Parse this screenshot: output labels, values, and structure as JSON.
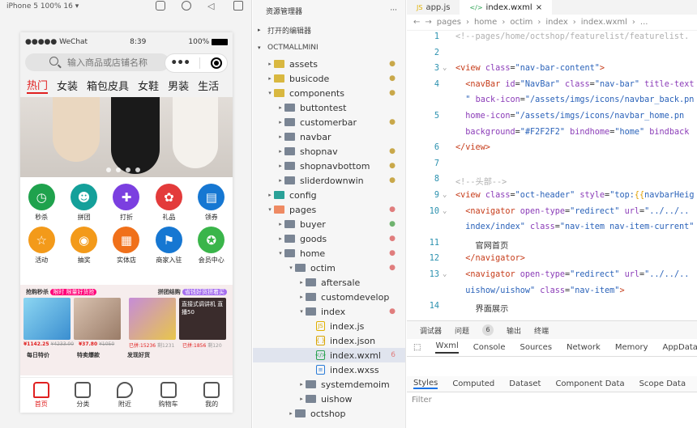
{
  "simulator": {
    "toolbar_label": "iPhone 5 100% 16 ▾",
    "status": {
      "carrier": "●●●●● WeChat",
      "time": "8:39",
      "battery": "100%"
    },
    "search_placeholder": "输入商品或店铺名称",
    "tabs": [
      "热门",
      "女装",
      "箱包皮具",
      "女鞋",
      "男装",
      "生活"
    ],
    "icons": [
      {
        "label": "秒杀",
        "color": "#1fa24d"
      },
      {
        "label": "拼团",
        "color": "#14a09a"
      },
      {
        "label": "打折",
        "color": "#7b3fe0"
      },
      {
        "label": "礼品",
        "color": "#e33b3b"
      },
      {
        "label": "领券",
        "color": "#1677d2"
      },
      {
        "label": "活动",
        "color": "#f39a1a"
      },
      {
        "label": "抽奖",
        "color": "#f39a1a"
      },
      {
        "label": "实体店",
        "color": "#f0701a"
      },
      {
        "label": "商家入驻",
        "color": "#1677d2"
      },
      {
        "label": "会员中心",
        "color": "#3ab54a"
      }
    ],
    "promo": {
      "left_title": "抢购秒杀",
      "left_pill": "限时 限量好货抢",
      "right_title": "拼团结购",
      "right_pill": "省钱好货拼着买",
      "p1": "¥1142.25",
      "p1_old": "¥4233.00",
      "p2": "¥37.80",
      "p2_old": "¥1050",
      "p3": "已拼:15236",
      "p3_b": "剩1231",
      "p4": "已拼:1856",
      "p4_b": "剩120",
      "row2": [
        "每日特价",
        "特卖爆款",
        "发现好货"
      ],
      "promo_text": "直接式调讲机 直播50"
    },
    "tabbar": [
      "首页",
      "分类",
      "附近",
      "购物车",
      "我的"
    ]
  },
  "explorer": {
    "title": "资源管理器",
    "more": "···",
    "open_editors": "打开的编辑器",
    "project": "OCTMALLMINI",
    "tree": [
      {
        "name": "assets",
        "indent": 0,
        "type": "folder",
        "color": "y",
        "arrow": "▸",
        "status": "●",
        "scol": "#c9a84a"
      },
      {
        "name": "busicode",
        "indent": 0,
        "type": "folder",
        "color": "y",
        "arrow": "▸",
        "status": "●",
        "scol": "#c9a84a"
      },
      {
        "name": "components",
        "indent": 0,
        "type": "folder",
        "color": "y",
        "arrow": "▾",
        "status": "●",
        "scol": "#c9a84a"
      },
      {
        "name": "buttontest",
        "indent": 1,
        "type": "folder",
        "color": "",
        "arrow": "▸",
        "status": "",
        "scol": ""
      },
      {
        "name": "customerbar",
        "indent": 1,
        "type": "folder",
        "color": "",
        "arrow": "▸",
        "status": "●",
        "scol": "#c9a84a"
      },
      {
        "name": "navbar",
        "indent": 1,
        "type": "folder",
        "color": "",
        "arrow": "▸",
        "status": "",
        "scol": ""
      },
      {
        "name": "shopnav",
        "indent": 1,
        "type": "folder",
        "color": "",
        "arrow": "▸",
        "status": "●",
        "scol": "#c9a84a"
      },
      {
        "name": "shopnavbottom",
        "indent": 1,
        "type": "folder",
        "color": "",
        "arrow": "▸",
        "status": "●",
        "scol": "#c9a84a"
      },
      {
        "name": "sliderdownwin",
        "indent": 1,
        "type": "folder",
        "color": "",
        "arrow": "▸",
        "status": "●",
        "scol": "#c9a84a"
      },
      {
        "name": "config",
        "indent": 0,
        "type": "folder",
        "color": "b",
        "arrow": "▸",
        "status": "",
        "scol": ""
      },
      {
        "name": "pages",
        "indent": 0,
        "type": "folder",
        "color": "o",
        "arrow": "▾",
        "status": "●",
        "scol": "#e07d7d"
      },
      {
        "name": "buyer",
        "indent": 1,
        "type": "folder",
        "color": "",
        "arrow": "▸",
        "status": "●",
        "scol": "#6fb36f"
      },
      {
        "name": "goods",
        "indent": 1,
        "type": "folder",
        "color": "",
        "arrow": "▸",
        "status": "●",
        "scol": "#e07d7d"
      },
      {
        "name": "home",
        "indent": 1,
        "type": "folder",
        "color": "",
        "arrow": "▾",
        "status": "●",
        "scol": "#e07d7d"
      },
      {
        "name": "octim",
        "indent": 2,
        "type": "folder",
        "color": "",
        "arrow": "▾",
        "status": "●",
        "scol": "#e07d7d"
      },
      {
        "name": "aftersale",
        "indent": 3,
        "type": "folder",
        "color": "",
        "arrow": "▸",
        "status": "",
        "scol": ""
      },
      {
        "name": "customdevelop",
        "indent": 3,
        "type": "folder",
        "color": "",
        "arrow": "▸",
        "status": "",
        "scol": ""
      },
      {
        "name": "index",
        "indent": 3,
        "type": "folder",
        "color": "",
        "arrow": "▾",
        "status": "●",
        "scol": "#e07d7d"
      },
      {
        "name": "index.js",
        "indent": 4,
        "type": "js",
        "color": "",
        "arrow": "",
        "status": "",
        "scol": ""
      },
      {
        "name": "index.json",
        "indent": 4,
        "type": "json",
        "color": "",
        "arrow": "",
        "status": "",
        "scol": ""
      },
      {
        "name": "index.wxml",
        "indent": 4,
        "type": "wxml",
        "color": "",
        "arrow": "",
        "status": "6",
        "scol": "#e07d7d",
        "selected": true
      },
      {
        "name": "index.wxss",
        "indent": 4,
        "type": "wxss",
        "color": "",
        "arrow": "",
        "status": "",
        "scol": ""
      },
      {
        "name": "systemdemoim",
        "indent": 3,
        "type": "folder",
        "color": "",
        "arrow": "▸",
        "status": "",
        "scol": ""
      },
      {
        "name": "uishow",
        "indent": 3,
        "type": "folder",
        "color": "",
        "arrow": "▸",
        "status": "",
        "scol": ""
      },
      {
        "name": "octshop",
        "indent": 2,
        "type": "folder",
        "color": "",
        "arrow": "▸",
        "status": "",
        "scol": ""
      }
    ]
  },
  "editor": {
    "tabs": [
      {
        "label": "app.js",
        "active": false
      },
      {
        "label": "index.wxml",
        "active": true
      }
    ],
    "breadcrumb": [
      "pages",
      "home",
      "octim",
      "index",
      "index.wxml",
      "..."
    ],
    "lines": [
      {
        "n": "1",
        "html": "<span class='cmt'>&lt;!--pages/home/octshop/featurelist/featurelist.</span>"
      },
      {
        "n": "2",
        "html": ""
      },
      {
        "n": "3",
        "fold": "⌄",
        "html": "<span class='tag'>&lt;view</span> <span class='atn'>class</span>=<span class='val'>\"nav-bar-content\"</span><span class='tag'>&gt;</span>"
      },
      {
        "n": "4",
        "html": "  <span class='tag'>&lt;navBar</span> <span class='atn'>id</span>=<span class='val'>\"NavBar\"</span> <span class='atn'>class</span>=<span class='val'>\"nav-bar\"</span> <span class='atn'>title-text</span>"
      },
      {
        "n": "",
        "html": "  <span class='val'>\"</span> <span class='atn'>back-icon</span>=<span class='val'>\"/assets/imgs/icons/navbar_back.pn</span>"
      },
      {
        "n": "5",
        "html": "  <span class='atn'>home-icon</span>=<span class='val'>\"/assets/imgs/icons/navbar_home.pn</span>"
      },
      {
        "n": "",
        "html": "  <span class='atn'>background</span>=<span class='val'>\"#F2F2F2\"</span> <span class='atn'>bindhome</span>=<span class='val'>\"home\"</span> <span class='atn'>bindback</span>"
      },
      {
        "n": "6",
        "html": "<span class='tag'>&lt;/view&gt;</span>"
      },
      {
        "n": "7",
        "html": ""
      },
      {
        "n": "8",
        "html": "<span class='cmt'>&lt;!--头部--&gt;</span>"
      },
      {
        "n": "9",
        "fold": "⌄",
        "html": "<span class='tag'>&lt;view</span> <span class='atn'>class</span>=<span class='val'>\"oct-header\"</span> <span class='atn'>style</span>=<span class='val'>\"top:<span class='ex'>{{</span>navbarHeig</span>"
      },
      {
        "n": "10",
        "fold": "⌄",
        "html": "  <span class='tag'>&lt;navigator</span> <span class='atn'>open-type</span>=<span class='val'>\"redirect\"</span> <span class='atn'>url</span>=<span class='val'>\"../../..</span>"
      },
      {
        "n": "",
        "html": "  <span class='val'>index/index\"</span> <span class='atn'>class</span>=<span class='val'>\"nav-item nav-item-current\"</span>"
      },
      {
        "n": "11",
        "html": "    官网首页"
      },
      {
        "n": "12",
        "html": "  <span class='tag'>&lt;/navigator&gt;</span>"
      },
      {
        "n": "13",
        "fold": "⌄",
        "html": "  <span class='tag'>&lt;navigator</span> <span class='atn'>open-type</span>=<span class='val'>\"redirect\"</span> <span class='atn'>url</span>=<span class='val'>\"../../..</span>"
      },
      {
        "n": "",
        "html": "  <span class='val'>uishow/uishow\"</span> <span class='atn'>class</span>=<span class='val'>\"nav-item\"</span><span class='tag'>&gt;</span>"
      },
      {
        "n": "14",
        "html": "    界面展示"
      }
    ],
    "devtools": {
      "top": [
        "调试器",
        "问题",
        "输出",
        "终端"
      ],
      "problems_count": "6",
      "tabs": [
        "Wxml",
        "Console",
        "Sources",
        "Network",
        "Memory",
        "AppData"
      ],
      "subtabs": [
        "Styles",
        "Computed",
        "Dataset",
        "Component Data",
        "Scope Data"
      ],
      "filter": "Filter"
    }
  }
}
